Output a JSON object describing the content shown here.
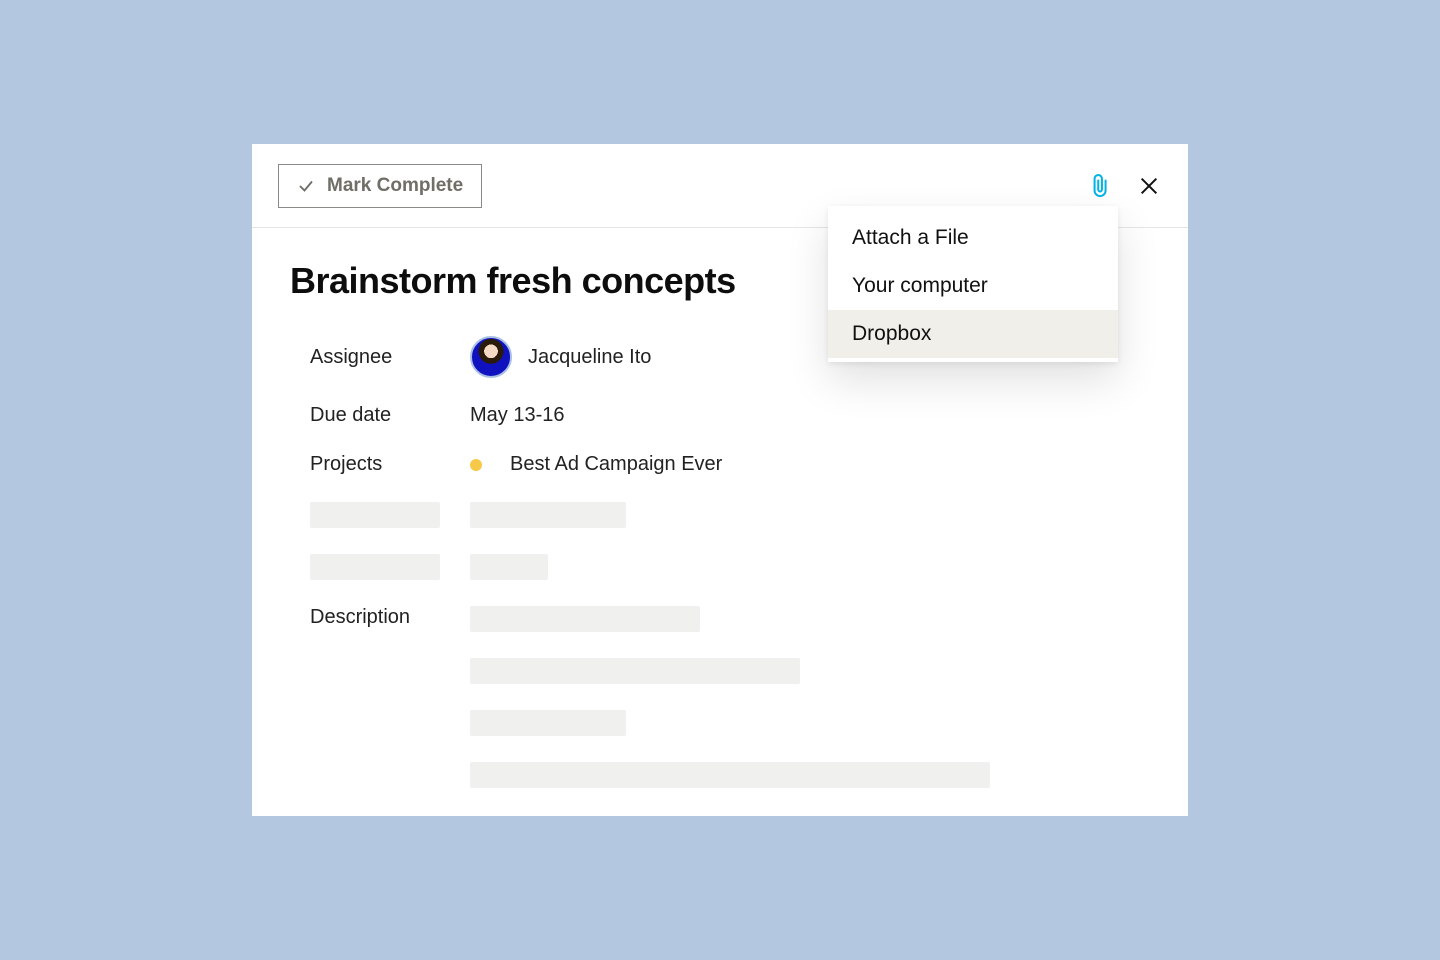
{
  "toolbar": {
    "mark_complete_label": "Mark Complete"
  },
  "task": {
    "title": "Brainstorm fresh concepts",
    "fields": {
      "assignee_label": "Assignee",
      "assignee_name": "Jacqueline Ito",
      "due_date_label": "Due date",
      "due_date_value": "May 13-16",
      "projects_label": "Projects",
      "project_name": "Best Ad Campaign Ever",
      "description_label": "Description"
    }
  },
  "attach_popover": {
    "title": "Attach a File",
    "items": [
      {
        "label": "Your computer",
        "key": "your-computer",
        "highlighted": false
      },
      {
        "label": "Dropbox",
        "key": "dropbox",
        "highlighted": true
      }
    ]
  },
  "colors": {
    "page_bg": "#b3c7e0",
    "attach_icon": "#00b3e6",
    "project_dot": "#f7c948",
    "skeleton": "#f0f0ee",
    "popover_hover": "#f0efe9"
  }
}
